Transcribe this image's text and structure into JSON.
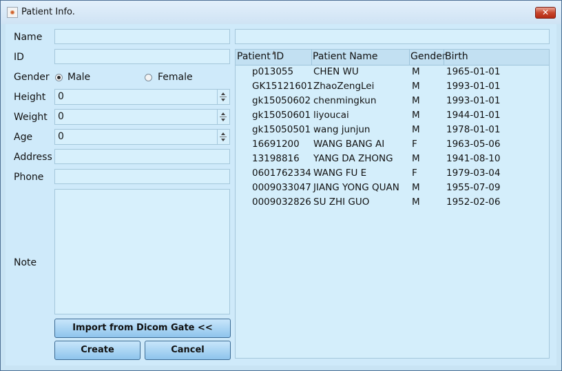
{
  "window": {
    "title": "Patient Info.",
    "close_glyph": "✕"
  },
  "form": {
    "name_label": "Name",
    "id_label": "ID",
    "gender_label": "Gender",
    "gender_options": [
      "Male",
      "Female"
    ],
    "gender_selected": "Male",
    "height_label": "Height",
    "height_value": "0",
    "weight_label": "Weight",
    "weight_value": "0",
    "age_label": "Age",
    "age_value": "0",
    "address_label": "Address",
    "phone_label": "Phone",
    "note_label": "Note"
  },
  "buttons": {
    "import": "Import from Dicom Gate <<",
    "create": "Create",
    "cancel": "Cancel"
  },
  "table": {
    "columns": [
      "Patient ID",
      "Patient Name",
      "Gender",
      "Birth"
    ],
    "rows": [
      [
        "p013055",
        "CHEN WU",
        "M",
        "1965-01-01"
      ],
      [
        "GK15121601",
        "ZhaoZengLei",
        "M",
        "1993-01-01"
      ],
      [
        "gk15050602",
        "chenmingkun",
        "M",
        "1993-01-01"
      ],
      [
        "gk15050601",
        "liyoucai",
        "M",
        "1944-01-01"
      ],
      [
        "gk15050501",
        "wang junjun",
        "M",
        "1978-01-01"
      ],
      [
        "16691200",
        "WANG BANG AI",
        "F",
        "1963-05-06"
      ],
      [
        "13198816",
        "YANG DA ZHONG",
        "M",
        "1941-08-10"
      ],
      [
        "0601762334",
        "WANG FU E",
        "F",
        "1979-03-04"
      ],
      [
        "0009033047",
        "JIANG YONG QUAN",
        "M",
        "1955-07-09"
      ],
      [
        "0009032826",
        "SU ZHI GUO",
        "M",
        "1952-02-06"
      ]
    ]
  }
}
